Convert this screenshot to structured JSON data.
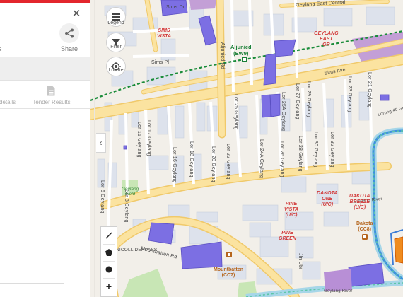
{
  "panel": {
    "close_glyph": "✕",
    "share_label": "Share",
    "cut_label": "s",
    "tabs": {
      "left_label": "details",
      "right_label": "Tender Results"
    }
  },
  "map_controls": {
    "legend_label": "Legend",
    "filter_label": "Filter",
    "locate_label": "Locate",
    "collapse_glyph": "‹",
    "draw_tools": [
      "pen-tool",
      "polygon-tool",
      "circle-tool",
      "zoom-in"
    ],
    "zoom_in_glyph": "+"
  },
  "road_labels": {
    "sims_dr": "Sims Dr",
    "sims_pl": "Sims Pl",
    "sims_ave": "Sims Ave",
    "geylang_east_central": "Geylang East Central",
    "aljunied_rd": "Aljunied Rd",
    "lor_25_geylang": "Lor 25 Geylang",
    "lor_25a_geylang": "Lor 25A Geylang",
    "lor_27_geylang": "Lor 27 Geylang",
    "lor_29_geylang": "Lor 29 Geylang",
    "lor_23_geylang": "Lor 23 Geylang",
    "lor_21_geylang": "Lor 21 Geylang",
    "lor_17_geylang": "Lor 17 Geylang",
    "lor_15_geylang": "Lor 15 Geylang",
    "lor_16_geylang": "Lor 16 Geylang",
    "lor_18_geylang": "Lor 18 Geylang",
    "lor_20_geylang": "Lor 20 Geylang",
    "lor_22_geylang": "Lor 22 Geylang",
    "lor_24a_geylang": "Lor 24A Geylang",
    "lor_26_geylang": "Lor 26 Geylang",
    "lor_28_geylang": "Lor 28 Geylang",
    "lor_30_geylang": "Lor 30 Geylang",
    "lor_32_geylang": "Lor 32 Geylang",
    "lor_6_geylang": "Lor 6 Geylang",
    "lor_8_geylang": "Lor 8 Geylang",
    "lorong_40_geylang": "Lorong 40 Geylang",
    "geylang_rd": "Geylang Rd",
    "geylang_river": "Geylang River",
    "mountbatten_rd": "Mountbatten Rd",
    "jln_ubi": "Jln Ubi",
    "nicoll_underpass": "NICOLL DERPASS"
  },
  "place_labels": {
    "sims_vista": [
      "SIMS",
      "VISTA"
    ],
    "geylang_east_gr": [
      "GEYLANG",
      "EAST",
      "GR"
    ],
    "aljunied_station": [
      "Aljunied",
      "(EW9)"
    ],
    "pine_vista": [
      "PINE",
      "VISTA",
      "(U/C)"
    ],
    "dakota_one": [
      "DAKOTA",
      "ONE",
      "(U/C)"
    ],
    "dakota_breeze": [
      "DAKOTA",
      "BREEZE",
      "(U/C)"
    ],
    "pine_green": [
      "PINE",
      "GREEN"
    ],
    "geylang_field": [
      "Geylang",
      "Field"
    ],
    "dakota_station": [
      "Dakota",
      "(CC8)"
    ],
    "mountbatten_station": [
      "Mountbatten",
      "(CC7)"
    ]
  },
  "colors": {
    "accent_red": "#e3262d",
    "road": "#fbe3a0",
    "road_edge": "#f0c96a",
    "building": "#d4d9e6",
    "highlight": "#7c6fe3",
    "mrt_line_green": "#1a8c3a",
    "circle_line": "#3d8fe0",
    "park": "#c8e6b5",
    "water": "#a6d6e8"
  }
}
